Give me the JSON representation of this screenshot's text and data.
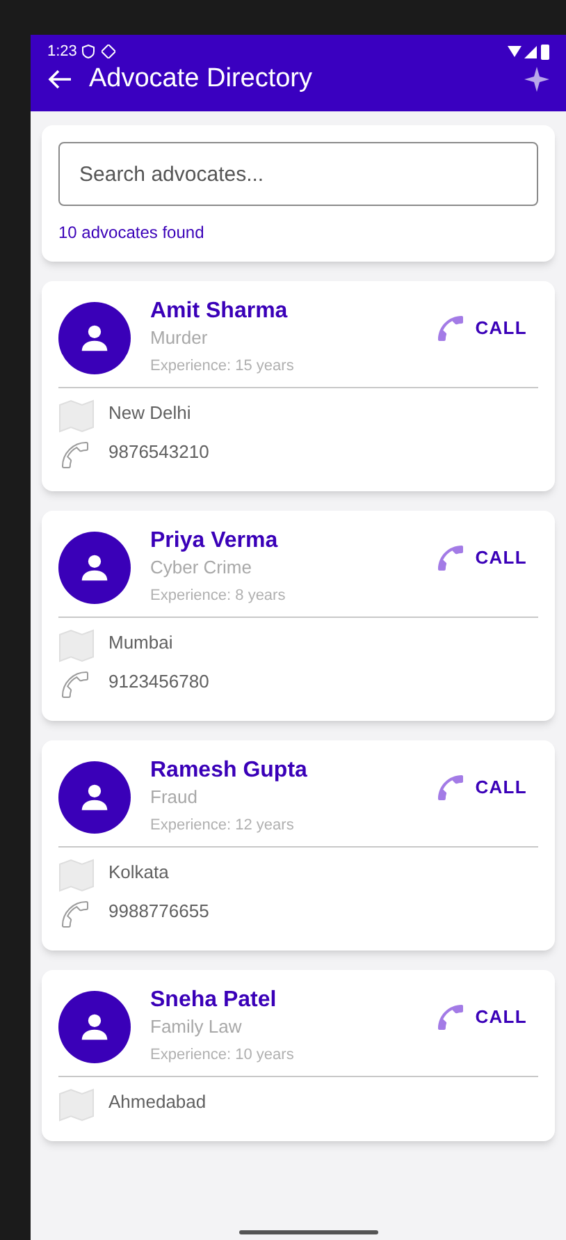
{
  "status_bar": {
    "time": "1:23"
  },
  "app_bar": {
    "title": "Advocate Directory"
  },
  "search": {
    "placeholder": "Search advocates...",
    "result_count": "10 advocates found"
  },
  "advocates": [
    {
      "name": "Amit Sharma",
      "specialty": "Murder",
      "experience": "Experience: 15 years",
      "city": "New Delhi",
      "phone": "9876543210",
      "call_label": "CALL"
    },
    {
      "name": "Priya Verma",
      "specialty": "Cyber Crime",
      "experience": "Experience: 8 years",
      "city": "Mumbai",
      "phone": "9123456780",
      "call_label": "CALL"
    },
    {
      "name": "Ramesh Gupta",
      "specialty": "Fraud",
      "experience": "Experience: 12 years",
      "city": "Kolkata",
      "phone": "9988776655",
      "call_label": "CALL"
    },
    {
      "name": "Sneha Patel",
      "specialty": "Family Law",
      "experience": "Experience: 10 years",
      "city": "Ahmedabad",
      "call_label": "CALL"
    }
  ]
}
